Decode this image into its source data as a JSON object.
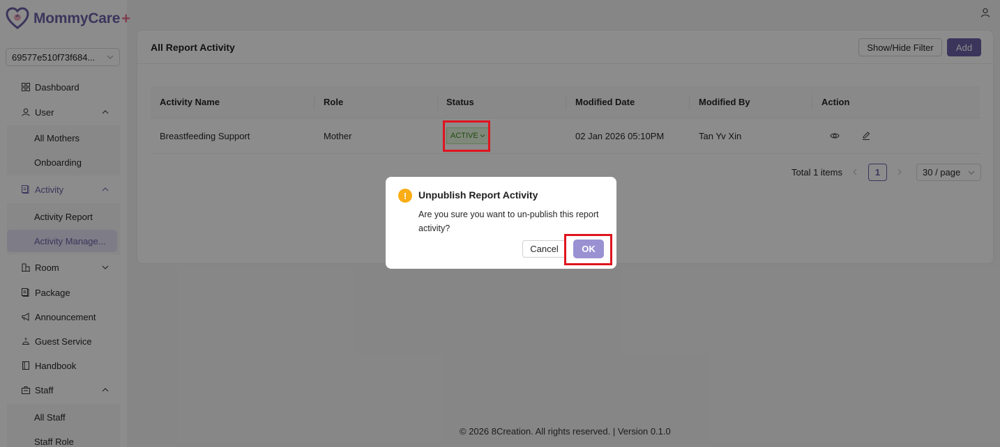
{
  "app": {
    "brand": "MommyCare",
    "brand_plus": "+",
    "branch_value": "69577e510f73f684..."
  },
  "sidebar": {
    "items": [
      {
        "label": "Dashboard",
        "icon": "dashboard-icon"
      },
      {
        "label": "User",
        "icon": "user-icon",
        "expanded": true,
        "children": [
          {
            "label": "All Mothers"
          },
          {
            "label": "Onboarding"
          }
        ]
      },
      {
        "label": "Activity",
        "icon": "activity-icon",
        "expanded": true,
        "active": true,
        "children": [
          {
            "label": "Activity Report"
          },
          {
            "label": "Activity Manage...",
            "selected": true
          }
        ]
      },
      {
        "label": "Room",
        "icon": "room-icon",
        "expanded": false
      },
      {
        "label": "Package",
        "icon": "package-icon"
      },
      {
        "label": "Announcement",
        "icon": "announcement-icon"
      },
      {
        "label": "Guest Service",
        "icon": "guest-service-icon"
      },
      {
        "label": "Handbook",
        "icon": "handbook-icon"
      },
      {
        "label": "Staff",
        "icon": "staff-icon",
        "expanded": true,
        "children": [
          {
            "label": "All Staff"
          },
          {
            "label": "Staff Role"
          }
        ]
      }
    ]
  },
  "card": {
    "title": "All Report Activity",
    "filter_label": "Show/Hide Filter",
    "add_label": "Add"
  },
  "table": {
    "columns": [
      "Activity Name",
      "Role",
      "Status",
      "Modified Date",
      "Modified By",
      "Action"
    ],
    "rows": [
      {
        "activity_name": "Breastfeeding Support",
        "role": "Mother",
        "status": "ACTIVE",
        "modified_date": "02 Jan 2026 05:10PM",
        "modified_by": "Tan Yv Xin",
        "actions": [
          "eye-icon",
          "edit-icon"
        ]
      }
    ]
  },
  "pagination": {
    "total_text": "Total 1 items",
    "current_page": "1",
    "page_size": "30 / page"
  },
  "footer": {
    "text": "© 2026 8Creation. All rights reserved. | Version 0.1.0"
  },
  "modal": {
    "icon": "warning-icon",
    "title": "Unpublish Report Activity",
    "body": "Are you sure you want to un-publish this report activity?",
    "cancel_label": "Cancel",
    "ok_label": "OK"
  },
  "colors": {
    "brand": "#6c61a8",
    "brand_accent": "#e7708a",
    "highlight": "#e0141e",
    "status_active_bg": "#e8f7e1",
    "status_active_text": "#3f8b21",
    "warning": "#faad14",
    "ok_button": "#9a91d3"
  }
}
